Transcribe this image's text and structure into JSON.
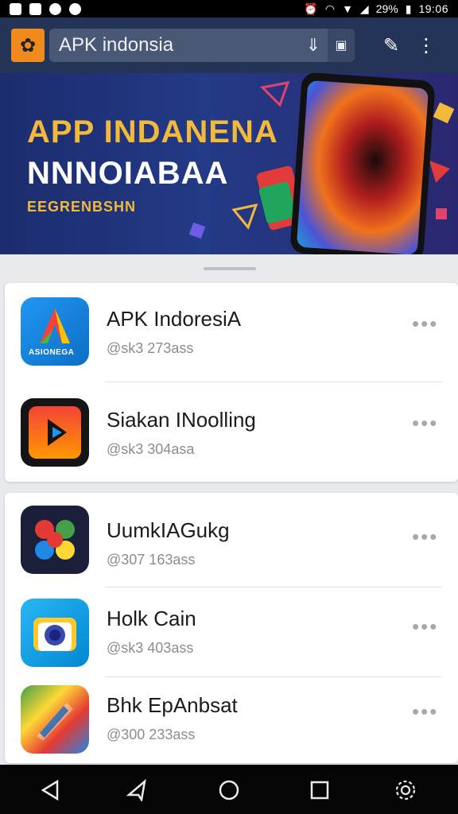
{
  "status_bar": {
    "battery": "29%",
    "time": "19:06"
  },
  "toolbar": {
    "url": "APK indonsia"
  },
  "banner": {
    "title": "APP INDANENA",
    "subtitle": "NNNOIABAA",
    "tagline": "EEGRENBSHN"
  },
  "apps_group1": [
    {
      "name": "APK IndoresiA",
      "meta": "@sk3  273ass",
      "icon_text": "ASIONEGA",
      "icon": "letter-a-app-icon"
    },
    {
      "name": "Siakan INoolling",
      "meta": "@sk3  304asa",
      "icon": "play-app-icon"
    }
  ],
  "apps_group2": [
    {
      "name": "UumkIAGukg",
      "meta": "@307  163ass",
      "icon": "multicolor-app-icon"
    },
    {
      "name": "Holk Cain",
      "meta": "@sk3  403ass",
      "icon": "camera-app-icon"
    },
    {
      "name": "Bhk EpAnbsat",
      "meta": "@300  233ass",
      "icon": "gradient-app-icon"
    }
  ],
  "colors": {
    "toolbar": "#233457",
    "banner_accent": "#f3b93b",
    "logo": "#f08a1c"
  }
}
